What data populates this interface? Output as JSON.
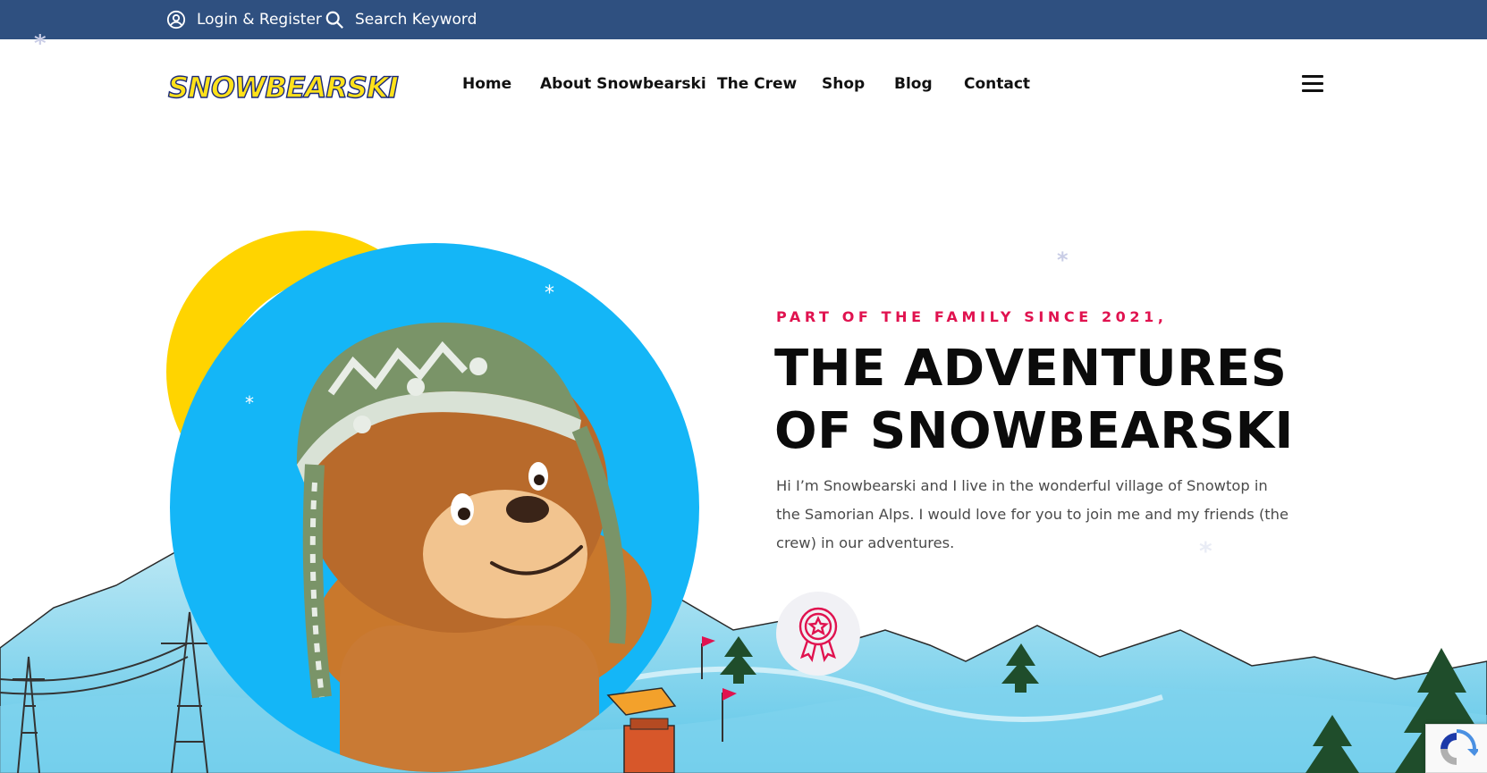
{
  "topbar": {
    "login_label": "Login & Register",
    "search_label": "Search Keyword"
  },
  "header": {
    "logo_text": "SNOWBEARSKI",
    "nav": [
      "Home",
      "About Snowbearski",
      "The Crew",
      "Shop",
      "Blog",
      "Contact"
    ]
  },
  "hero": {
    "eyebrow": "PART OF THE FAMILY SINCE 2021,",
    "title_line1": "THE ADVENTURES",
    "title_line2": "OF SNOWBEARSKI",
    "intro": "Hi I’m Snowbearski and I live in the wonderful village of Snowtop in the Samorian Alps. I would love for you to join me and my friends (the crew) in our adventures."
  },
  "icons": [
    "user-circle-icon",
    "search-icon",
    "hamburger-menu-icon",
    "award-ribbon-icon",
    "recaptcha-icon",
    "snowflake-icon"
  ],
  "colors": {
    "topbar": "#2f5080",
    "accent": "#e0124f",
    "sky_circle": "#14b6f7",
    "sun_ring": "#ffd400",
    "text": "#111111"
  }
}
